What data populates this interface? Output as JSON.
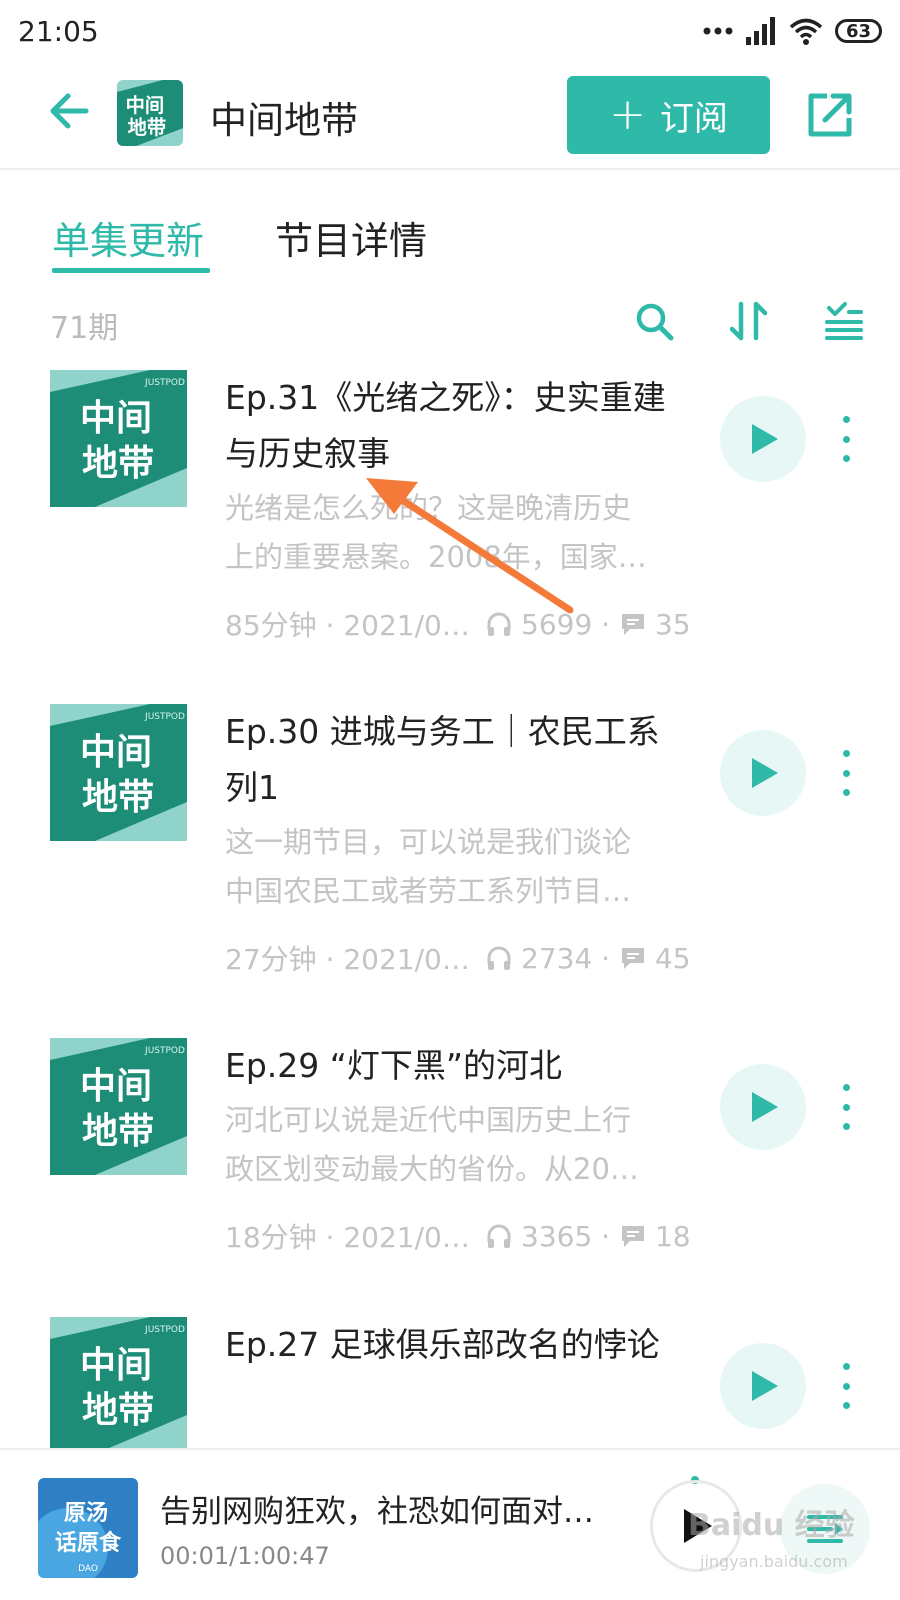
{
  "status_bar": {
    "time": "21:05",
    "battery": "63"
  },
  "header": {
    "podcast_name": "中间地带",
    "subscribe_label": "订阅"
  },
  "tabs": [
    {
      "label": "单集更新",
      "active": true
    },
    {
      "label": "节目详情",
      "active": false
    }
  ],
  "episode_count": "71期",
  "cover_text": {
    "line1": "中间",
    "line2": "地带",
    "brand": "JUSTPOD"
  },
  "episodes": [
    {
      "title": "Ep.31《光绪之死》：史实重建与历史叙事",
      "desc_line1": "光绪是怎么死的？这是晚清历史",
      "desc_line2": "上的重要悬案。2008年，国家…",
      "duration_date": "85分钟 · 2021/0…",
      "listens": "5699",
      "comments": "35"
    },
    {
      "title": "Ep.30 进城与务工｜农民工系列1",
      "desc_line1": "这一期节目，可以说是我们谈论",
      "desc_line2": "中国农民工或者劳工系列节目…",
      "duration_date": "27分钟 · 2021/0…",
      "listens": "2734",
      "comments": "45"
    },
    {
      "title": "Ep.29 “灯下黑”的河北",
      "desc_line1": "河北可以说是近代中国历史上行",
      "desc_line2": "政区划变动最大的省份。从20…",
      "duration_date": "18分钟 · 2021/0…",
      "listens": "3365",
      "comments": "18"
    },
    {
      "title": "Ep.27 足球俱乐部改名的悖论"
    }
  ],
  "mini_player": {
    "title": "告别网购狂欢，社恐如何面对…",
    "time": "00:01/1:00:47",
    "cover_line1": "原汤",
    "cover_line2": "话原食",
    "cover_brand": "DAO"
  },
  "watermark": {
    "main": "Baidu 经验",
    "sub": "jingyan.baidu.com"
  },
  "colors": {
    "accent": "#2fb9a8",
    "annotation_arrow": "#f47a3a"
  },
  "icons": [
    "back-arrow-icon",
    "share-icon",
    "search-icon",
    "sort-icon",
    "filter-icon",
    "play-icon",
    "more-icon",
    "headphones-icon",
    "comment-icon",
    "playlist-icon"
  ]
}
